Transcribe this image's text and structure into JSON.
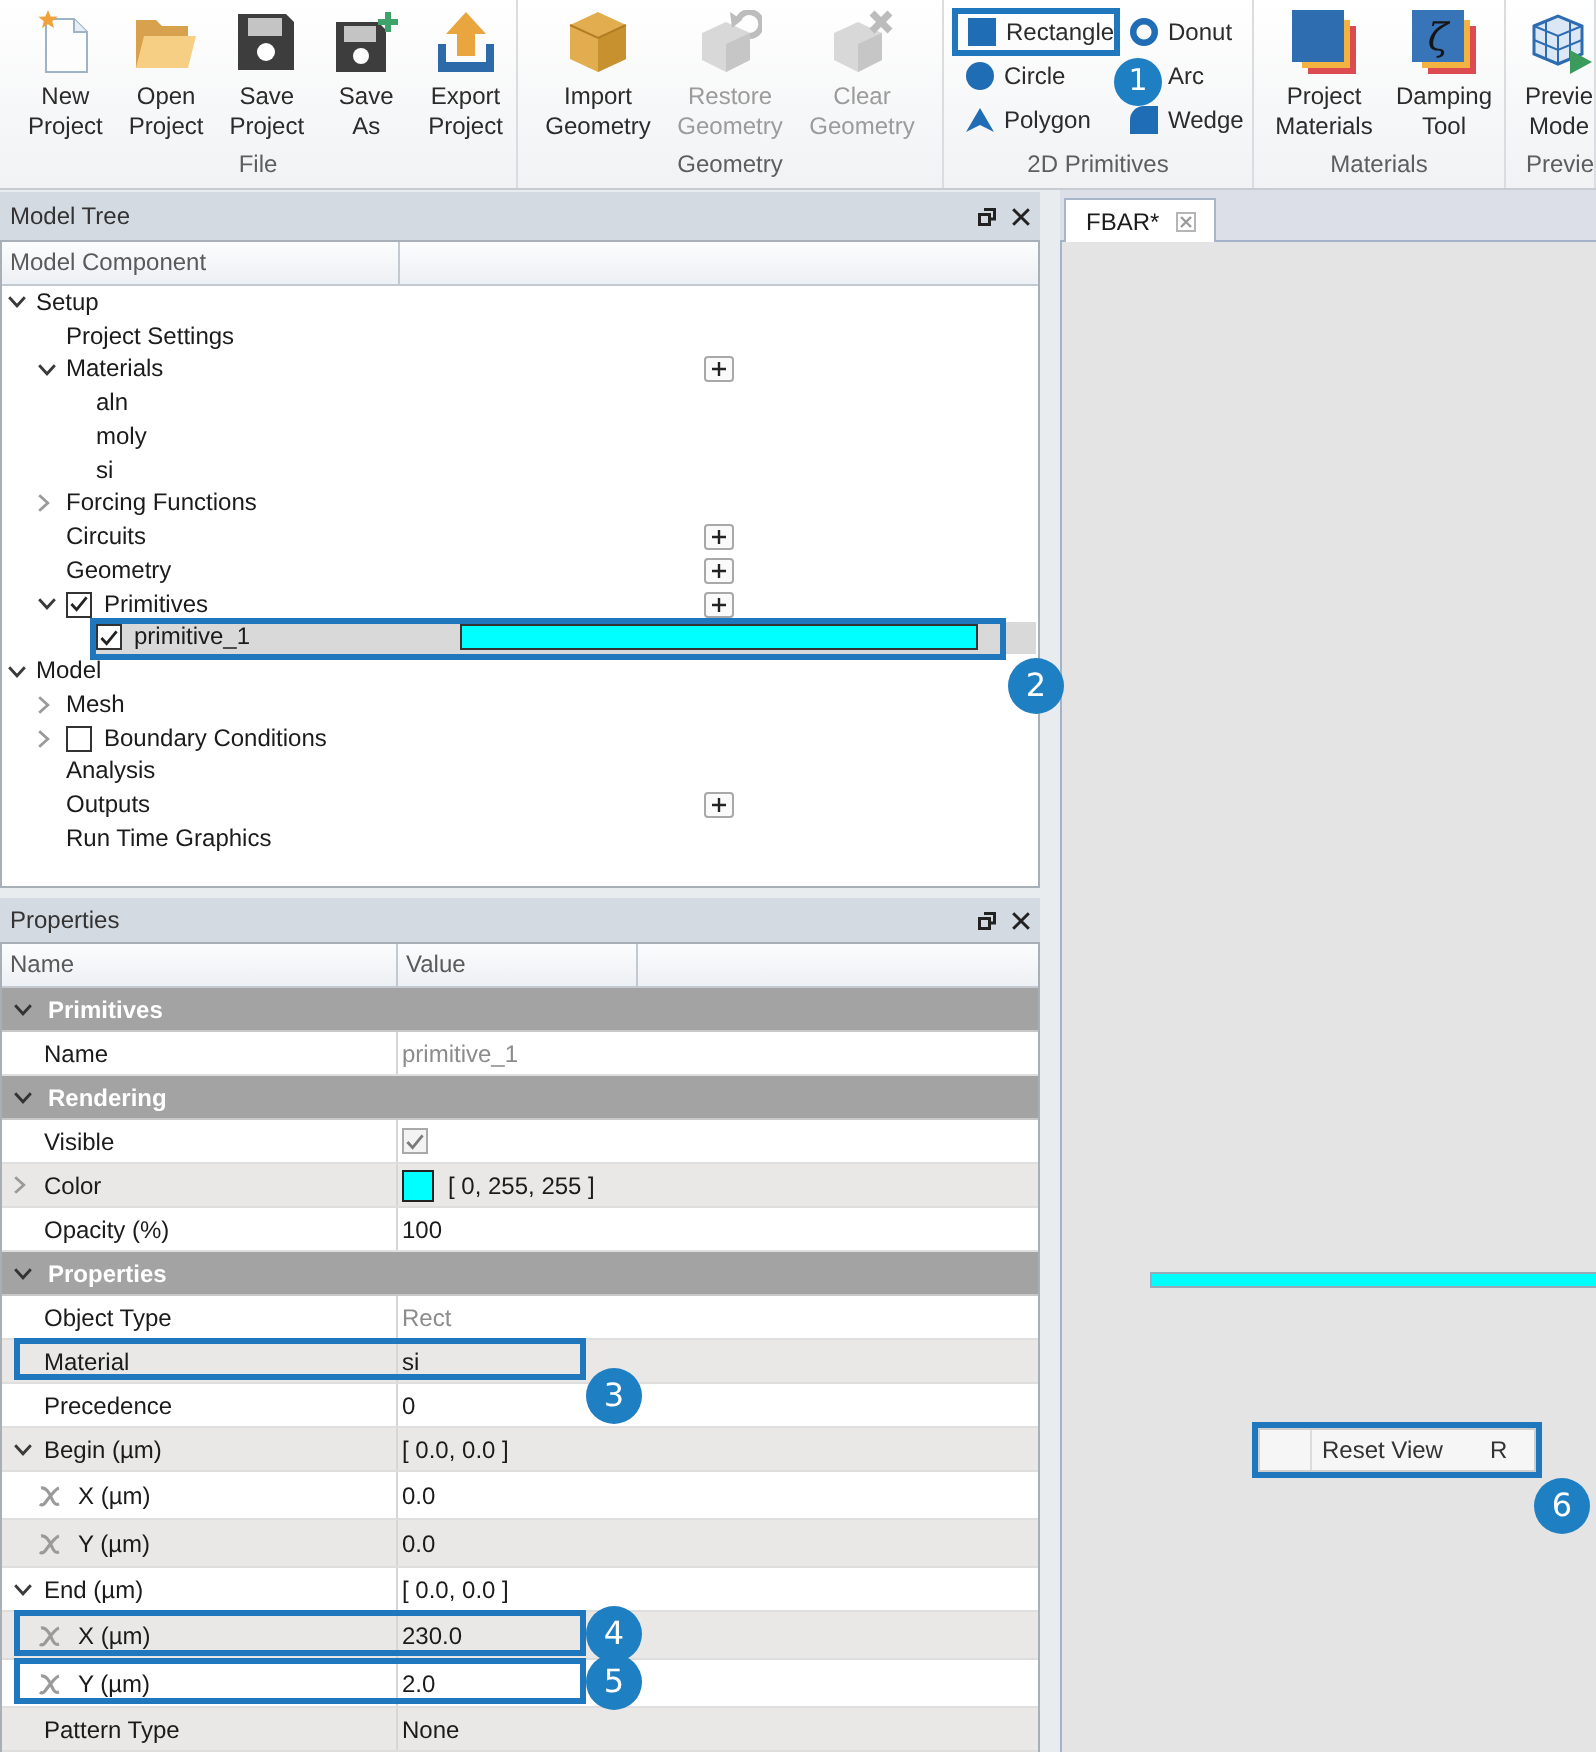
{
  "ribbon": {
    "groups": [
      {
        "label": "File",
        "kind": "large",
        "buttons": [
          {
            "lines": [
              "New",
              "Project"
            ],
            "kind": "new-file",
            "disabled": false
          },
          {
            "lines": [
              "Open",
              "Project"
            ],
            "kind": "folder",
            "disabled": false
          },
          {
            "lines": [
              "Save",
              "Project"
            ],
            "kind": "save",
            "disabled": false
          },
          {
            "lines": [
              "Save",
              "As"
            ],
            "kind": "save-as",
            "disabled": false
          },
          {
            "lines": [
              "Export",
              "Project"
            ],
            "kind": "export",
            "disabled": false
          }
        ]
      },
      {
        "label": "Geometry",
        "kind": "large",
        "buttons": [
          {
            "lines": [
              "Import",
              "Geometry"
            ],
            "kind": "import-geometry",
            "disabled": false
          },
          {
            "lines": [
              "Restore",
              "Geometry"
            ],
            "kind": "restore-geometry",
            "disabled": true
          },
          {
            "lines": [
              "Clear",
              "Geometry"
            ],
            "kind": "clear-geometry",
            "disabled": true
          }
        ]
      },
      {
        "label": "2D Primitives",
        "kind": "small",
        "buttons": [
          {
            "label": "Rectangle",
            "kind": "rectangle",
            "disabled": false,
            "callout": "1"
          },
          {
            "label": "Donut",
            "kind": "donut",
            "disabled": false
          },
          {
            "label": "Circle",
            "kind": "circle",
            "disabled": false
          },
          {
            "label": "Arc",
            "kind": "arc",
            "disabled": false
          },
          {
            "label": "Polygon",
            "kind": "polygon",
            "disabled": false
          },
          {
            "label": "Wedge",
            "kind": "wedge",
            "disabled": false
          }
        ]
      },
      {
        "label": "Materials",
        "kind": "large",
        "buttons": [
          {
            "lines": [
              "Project",
              "Materials"
            ],
            "kind": "materials",
            "disabled": false
          },
          {
            "lines": [
              "Damping",
              "Tool"
            ],
            "kind": "damping",
            "glyph": "ζ",
            "disabled": false
          }
        ]
      },
      {
        "label": "Previe",
        "kind": "large",
        "buttons": [
          {
            "lines": [
              "Previe",
              "Mode"
            ],
            "kind": "preview",
            "disabled": false
          }
        ]
      }
    ]
  },
  "model_tree": {
    "title": "Model Tree",
    "columns": [
      "Model Component"
    ],
    "items": [
      {
        "label": "Setup",
        "expanded": true,
        "selected": false,
        "children": [
          {
            "label": "Project Settings",
            "selected": false
          },
          {
            "label": "Materials",
            "expanded": true,
            "selected": false,
            "add_button": true,
            "children": [
              {
                "label": "aln",
                "selected": false
              },
              {
                "label": "moly",
                "selected": false
              },
              {
                "label": "si",
                "selected": false
              }
            ]
          },
          {
            "label": "Forcing Functions",
            "expanded": false,
            "selected": false
          },
          {
            "label": "Circuits",
            "selected": false,
            "add_button": true
          },
          {
            "label": "Geometry",
            "selected": false,
            "add_button": true
          },
          {
            "label": "Primitives",
            "expanded": true,
            "checked": true,
            "selected": false,
            "add_button": true,
            "children": [
              {
                "label": "primitive_1",
                "checked": true,
                "selected": true,
                "color": "#00ffff",
                "callout": "2"
              }
            ]
          }
        ]
      },
      {
        "label": "Model",
        "expanded": true,
        "selected": false,
        "children": [
          {
            "label": "Mesh",
            "expanded": false,
            "selected": false
          },
          {
            "label": "Boundary Conditions",
            "expanded": false,
            "checked": false,
            "selected": false
          },
          {
            "label": "Analysis",
            "selected": false
          },
          {
            "label": "Outputs",
            "selected": false,
            "add_button": true
          },
          {
            "label": "Run Time Graphics",
            "selected": false
          }
        ]
      }
    ]
  },
  "properties": {
    "title": "Properties",
    "columns": [
      "Name",
      "Value"
    ],
    "sections": [
      {
        "label": "Primitives",
        "expanded": true,
        "rows": [
          {
            "name": "Name",
            "kind": "text",
            "value": "primitive_1",
            "disabled": true
          }
        ]
      },
      {
        "label": "Rendering",
        "expanded": true,
        "rows": [
          {
            "name": "Visible",
            "kind": "checkbox",
            "checked": true,
            "disabled": true
          },
          {
            "name": "Color",
            "kind": "color",
            "color": "#00ffff",
            "value": "[ 0, 255, 255 ]",
            "expanded": false
          },
          {
            "name": "Opacity (%)",
            "kind": "text",
            "value": "100",
            "disabled": false
          }
        ]
      },
      {
        "label": "Properties",
        "expanded": true,
        "rows": [
          {
            "name": "Object Type",
            "kind": "text",
            "value": "Rect",
            "disabled": true
          },
          {
            "name": "Material",
            "kind": "text",
            "value": "si",
            "disabled": false,
            "callout": "3"
          },
          {
            "name": "Precedence",
            "kind": "text",
            "value": "0",
            "disabled": false
          },
          {
            "name": "Begin (µm)",
            "kind": "text",
            "value": "[ 0.0, 0.0 ]",
            "disabled": false,
            "expanded": true,
            "children": [
              {
                "name": "X (µm)",
                "kind": "text",
                "value": "0.0",
                "disabled": false
              },
              {
                "name": "Y (µm)",
                "kind": "text",
                "value": "0.0",
                "disabled": false
              }
            ]
          },
          {
            "name": "End (µm)",
            "kind": "text",
            "value": "[ 0.0, 0.0 ]",
            "disabled": false,
            "expanded": true,
            "children": [
              {
                "name": "X (µm)",
                "kind": "text",
                "value": "230.0",
                "disabled": false,
                "callout": "4"
              },
              {
                "name": "Y (µm)",
                "kind": "text",
                "value": "2.0",
                "disabled": false,
                "callout": "5"
              }
            ]
          },
          {
            "name": "Pattern Type",
            "kind": "text",
            "value": "None",
            "disabled": false
          }
        ]
      }
    ]
  },
  "document_tabs": [
    {
      "label": "FBAR*",
      "selected": true
    }
  ],
  "canvas": {
    "shapes": [
      {
        "kind": "rect",
        "color": "#00ffff"
      }
    ],
    "context_menu": {
      "callout": "6",
      "items": [
        {
          "label": "Reset View",
          "shortcut": "R"
        }
      ]
    }
  }
}
